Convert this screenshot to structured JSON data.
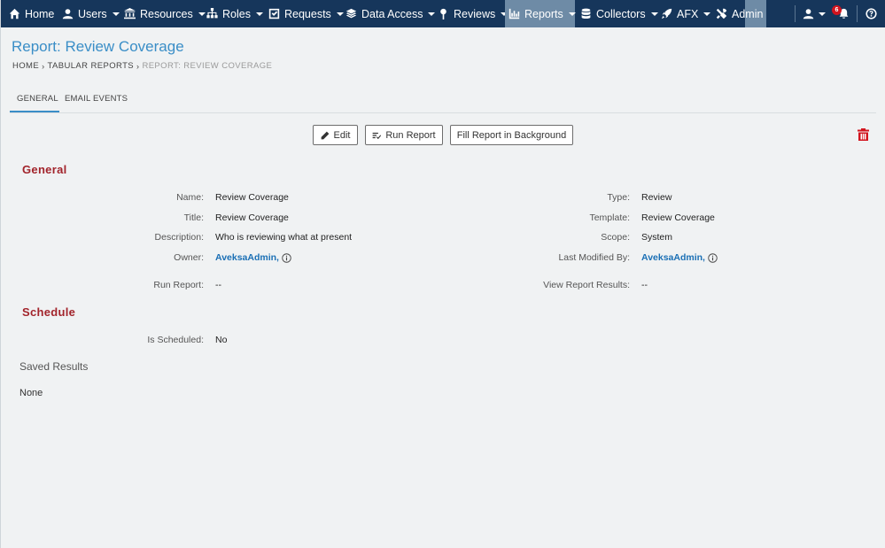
{
  "nav": {
    "home": "Home",
    "users": "Users",
    "resources": "Resources",
    "roles": "Roles",
    "requests": "Requests",
    "data_access": "Data Access",
    "reviews": "Reviews",
    "reports": "Reports",
    "collectors": "Collectors",
    "afx": "AFX",
    "admin": "Admin",
    "notification_count": "6"
  },
  "page": {
    "title": "Report: Review Coverage",
    "breadcrumb": [
      "HOME",
      "TABULAR REPORTS",
      "REPORT: REVIEW COVERAGE"
    ]
  },
  "tabs": [
    "GENERAL",
    "EMAIL EVENTS"
  ],
  "actions": {
    "edit": "Edit",
    "run_report": "Run Report",
    "fill_background": "Fill Report in Background"
  },
  "general": {
    "heading": "General",
    "left": [
      {
        "label": "Name:",
        "value": "Review Coverage"
      },
      {
        "label": "Title:",
        "value": "Review Coverage"
      },
      {
        "label": "Description:",
        "value": "Who is reviewing what at present"
      },
      {
        "label": "Owner:",
        "value": "AveksaAdmin,"
      },
      {
        "label": "Run Report:",
        "value": "--"
      }
    ],
    "right": [
      {
        "label": "Type:",
        "value": "Review"
      },
      {
        "label": "Template:",
        "value": "Review Coverage"
      },
      {
        "label": "Scope:",
        "value": "System"
      },
      {
        "label": "Last Modified By:",
        "value": "AveksaAdmin,"
      },
      {
        "label": "View Report Results:",
        "value": "--"
      }
    ]
  },
  "schedule": {
    "heading": "Schedule",
    "is_scheduled_label": "Is Scheduled:",
    "is_scheduled_value": "No"
  },
  "saved_results": {
    "heading": "Saved Results",
    "value": "None"
  },
  "colors": {
    "nav_bg": "#16365b",
    "accent": "#3a8ec7",
    "section_title": "#a2242b",
    "link": "#1a6fb5",
    "delete": "#d2141e"
  }
}
